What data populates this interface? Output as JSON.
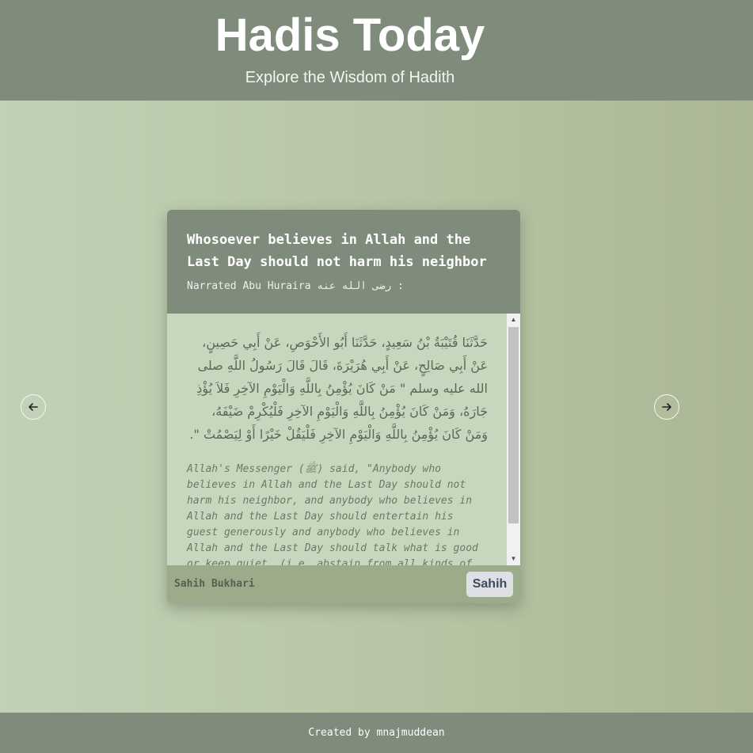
{
  "header": {
    "title": "Hadis Today",
    "subtitle": "Explore the Wisdom of Hadith"
  },
  "hadith": {
    "title": "Whosoever believes in Allah and the Last Day should not harm his neighbor",
    "narrator": "Narrated Abu Huraira رضى الله عنه :",
    "arabic": "حَدَّثَنَا قُتَيْبَةُ بْنُ سَعِيدٍ، حَدَّثَنَا أَبُو الأَحْوَصِ، عَنْ أَبِي حَصِينٍ، عَنْ أَبِي صَالِحٍ، عَنْ أَبِي هُرَيْرَةَ، قَالَ قَالَ رَسُولُ اللَّهِ صلى الله عليه وسلم \" مَنْ كَانَ يُؤْمِنُ بِاللَّهِ وَالْيَوْمِ الآخِرِ فَلاَ يُؤْذِ جَارَهُ، وَمَنْ كَانَ يُؤْمِنُ بِاللَّهِ وَالْيَوْمِ الآخِرِ فَلْيُكْرِمْ ضَيْفَهُ، وَمَنْ كَانَ يُؤْمِنُ بِاللَّهِ وَالْيَوْمِ الآخِرِ فَلْيَقُلْ خَيْرًا أَوْ لِيَصْمُتْ \".",
    "english": "Allah's Messenger (ﷺ) said, \"Anybody who believes in Allah and the Last Day should not harm his neighbor, and anybody who believes in Allah and the Last Day should entertain his guest generously and anybody who believes in Allah and the Last Day should talk what is good or keep quiet. (i.e. abstain from all kinds of evil and dirty talk).\"",
    "book": "Sahih Bukhari",
    "grade": "Sahih"
  },
  "navigation": {
    "prev_icon": "arrow-left-icon",
    "next_icon": "arrow-right-icon"
  },
  "footer": {
    "credit": "Created by mnajmuddean"
  },
  "colors": {
    "header_bg": "#7f8b7b",
    "card_body_bg": "#c5d8be",
    "card_footer_bg": "#9cab89",
    "grade_badge_bg": "#dde1e6"
  }
}
